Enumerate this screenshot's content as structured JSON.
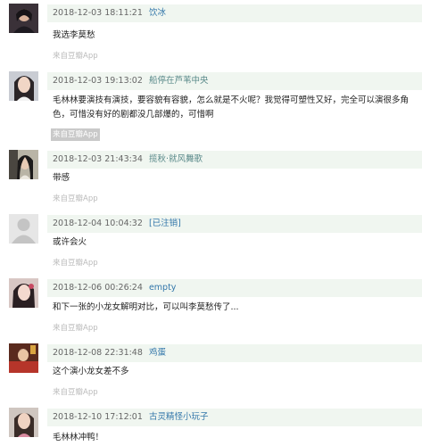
{
  "comments": [
    {
      "time": "2018-12-03 18:11:21",
      "author": "饮冰",
      "author_style": "normal",
      "text": "我选李莫愁",
      "source": "来自豆瓣App",
      "avatar": "dark-portrait-avatar"
    },
    {
      "time": "2018-12-03 19:13:02",
      "author": "船停在芦苇中央",
      "author_style": "muted",
      "text": "毛林林要演技有演技，要容貌有容貌，怎么就是不火呢？我觉得可塑性又好，完全可以演很多角色，可惜没有好的剧都没几部爆的，可惜啊",
      "source": "来自豆瓣App",
      "source_highlight": true,
      "avatar": "woman-portrait-avatar"
    },
    {
      "time": "2018-12-03 21:43:34",
      "author": "揽秋·就风舞歌",
      "author_style": "muted",
      "text": "带感",
      "source": "来自豆瓣App",
      "avatar": "costume-avatar"
    },
    {
      "time": "2018-12-04 10:04:32",
      "author": "[已注销]",
      "author_style": "normal",
      "text": "或许会火",
      "source": "来自豆瓣App",
      "avatar": "default-user-avatar"
    },
    {
      "time": "2018-12-06 00:26:24",
      "author": "empty",
      "author_style": "normal",
      "text": "和下一张的小龙女解明对比，可以叫李莫愁传了...",
      "source": "来自豆瓣App",
      "avatar": "woman-portrait-avatar"
    },
    {
      "time": "2018-12-08 22:31:48",
      "author": "鸡蛋",
      "author_style": "normal",
      "text": "这个演小龙女差不多",
      "source": "来自豆瓣App",
      "avatar": "red-costume-avatar"
    },
    {
      "time": "2018-12-10 17:12:01",
      "author": "古灵精怪小玩子",
      "author_style": "normal",
      "text": "毛林林冲鸭！",
      "source": "",
      "avatar": "woman-portrait-avatar"
    }
  ]
}
